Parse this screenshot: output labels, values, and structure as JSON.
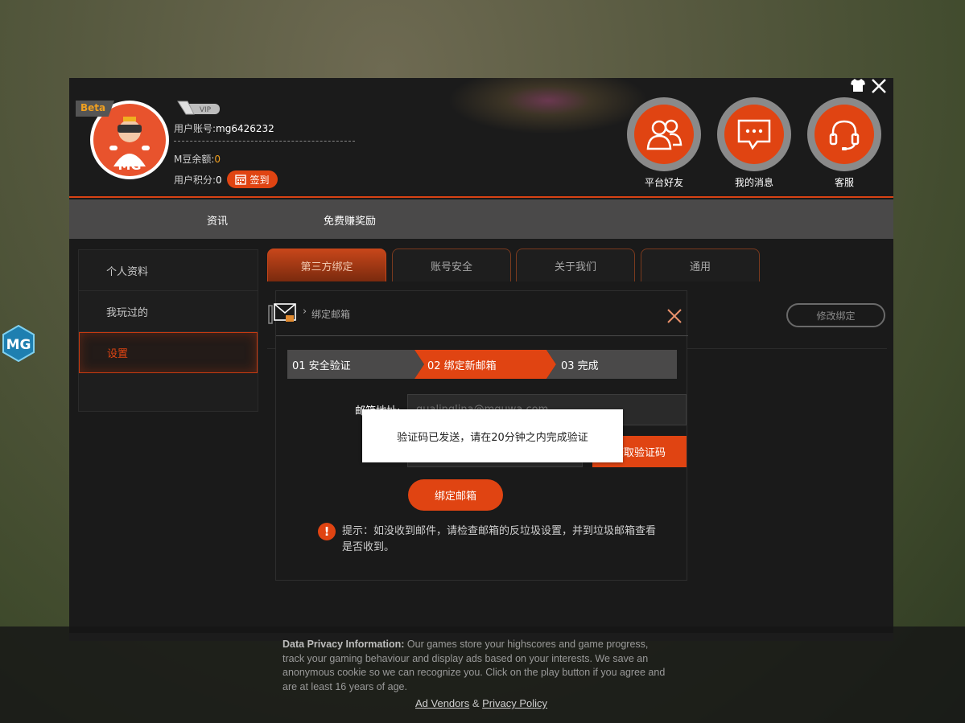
{
  "side_logo": "MG",
  "header": {
    "beta": "Beta",
    "vip": "VIP",
    "avatar_text": "MG",
    "account_label": "用户账号:",
    "account_value": "mg6426232",
    "balance_label": "M豆余额:",
    "balance_value": "0",
    "points_label": "用户积分:",
    "points_value": "0",
    "signin_label": "签到",
    "circles": [
      {
        "label": "平台好友",
        "icon": "friends-icon"
      },
      {
        "label": "我的消息",
        "icon": "message-icon"
      },
      {
        "label": "客服",
        "icon": "headset-icon"
      }
    ]
  },
  "nav": [
    "资讯",
    "免费赚奖励"
  ],
  "sidebar": [
    "个人资料",
    "我玩过的",
    "设置"
  ],
  "tabs": [
    "第三方绑定",
    "账号安全",
    "关于我们",
    "通用"
  ],
  "modify_button": "修改绑定",
  "modal": {
    "breadcrumb_sep": "›",
    "title": "绑定邮箱",
    "steps": [
      "01 安全验证",
      "02 绑定新邮箱",
      "03 完成"
    ],
    "email_label": "邮箱地址:",
    "email_placeholder": "qualinglina@mguwa.com",
    "get_code": "获取验证码",
    "bind_button": "绑定邮箱",
    "hint": "提示：如没收到邮件，请检查邮箱的反垃圾设置，并到垃圾邮箱查看是否收到。"
  },
  "tooltip": "验证码已发送，请在20分钟之内完成验证",
  "privacy": {
    "heading": "Data Privacy Information:",
    "body": "Our games store your highscores and game progress, track your gaming behaviour and display ads based on your interests. We save an anonymous cookie so we can recognize you. Click on the play button if you agree and are at least 16 years of age.",
    "vendors": "Ad Vendors",
    "amp": "&",
    "policy": "Privacy Policy"
  },
  "colors": {
    "accent": "#e04412",
    "header_bg": "#1b1b1b",
    "nav_bg": "#4a4949"
  }
}
